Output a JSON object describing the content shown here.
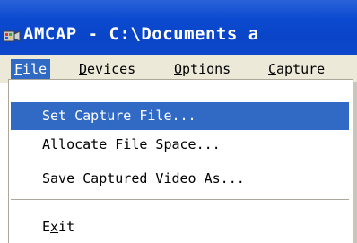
{
  "window": {
    "title": "AMCAP - C:\\Documents a",
    "icon": "camera-app-icon"
  },
  "menubar": {
    "items": [
      {
        "label": "File",
        "mnemonic": "F",
        "active": true
      },
      {
        "label": "Devices",
        "mnemonic": "D"
      },
      {
        "label": "Options",
        "mnemonic": "O"
      },
      {
        "label": "Capture",
        "mnemonic": "C"
      }
    ]
  },
  "file_menu": {
    "items": [
      {
        "label": "Set Capture File...",
        "selected": true
      },
      {
        "label": "Allocate File Space..."
      },
      {
        "label": "Save Captured Video As..."
      },
      {
        "label": "Exit",
        "mnemonic": "x"
      }
    ]
  },
  "colors": {
    "titlebar": "#0b4ad0",
    "menubar": "#ece9d8",
    "highlight": "#316ac5",
    "menu_bg": "#ffffff"
  }
}
